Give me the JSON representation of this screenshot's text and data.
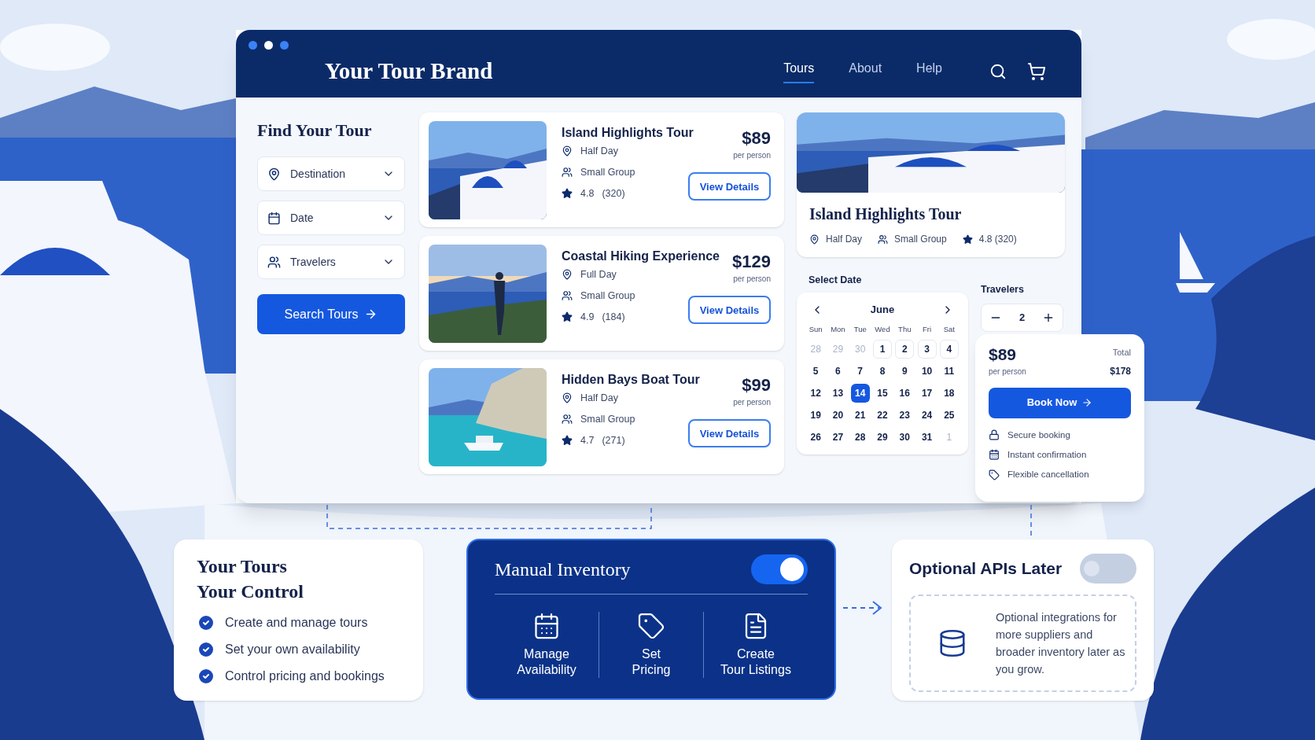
{
  "header": {
    "brand": "Your Tour Brand",
    "nav": [
      {
        "label": "Tours",
        "selected": true
      },
      {
        "label": "About",
        "selected": false
      },
      {
        "label": "Help",
        "selected": false
      }
    ]
  },
  "filters": {
    "title": "Find Your Tour",
    "fields": [
      {
        "kind": "location",
        "label": "Destination"
      },
      {
        "kind": "date",
        "label": "Date"
      },
      {
        "kind": "people",
        "label": "Travelers"
      }
    ],
    "button": "Search Tours"
  },
  "tours": [
    {
      "title": "Island Highlights Tour",
      "duration": "Half Day",
      "group": "Small Group",
      "rating": "4.8",
      "reviews": "(320)",
      "price": "$89",
      "unit": "per person",
      "button": "View Details"
    },
    {
      "title": "Coastal Hiking Experience",
      "duration": "Full Day",
      "group": "Small Group",
      "rating": "4.9",
      "reviews": "(184)",
      "price": "$129",
      "unit": "per person",
      "button": "View Details"
    },
    {
      "title": "Hidden Bays Boat Tour",
      "duration": "Half Day",
      "group": "Small Group",
      "rating": "4.7",
      "reviews": "(271)",
      "price": "$99",
      "unit": "per person",
      "button": "View Details"
    }
  ],
  "detail": {
    "title": "Island Highlights Tour",
    "duration": "Half Day",
    "group": "Small Group",
    "rating": "4.8 (320)"
  },
  "calendar": {
    "label": "Select Date",
    "month": "June",
    "weekdays": [
      "Sun",
      "Mon",
      "Tue",
      "Wed",
      "Thu",
      "Fri",
      "Sat"
    ],
    "days": [
      {
        "label": "28",
        "muted": true,
        "selected": false,
        "boxed": false
      },
      {
        "label": "29",
        "muted": true,
        "selected": false,
        "boxed": false
      },
      {
        "label": "30",
        "muted": true,
        "selected": false,
        "boxed": false
      },
      {
        "label": "1",
        "muted": false,
        "selected": false,
        "boxed": true
      },
      {
        "label": "2",
        "muted": false,
        "selected": false,
        "boxed": true
      },
      {
        "label": "3",
        "muted": false,
        "selected": false,
        "boxed": true
      },
      {
        "label": "4",
        "muted": false,
        "selected": false,
        "boxed": true
      },
      {
        "label": "5",
        "muted": false,
        "selected": false,
        "boxed": false
      },
      {
        "label": "6",
        "muted": false,
        "selected": false,
        "boxed": false
      },
      {
        "label": "7",
        "muted": false,
        "selected": false,
        "boxed": false
      },
      {
        "label": "8",
        "muted": false,
        "selected": false,
        "boxed": false
      },
      {
        "label": "9",
        "muted": false,
        "selected": false,
        "boxed": false
      },
      {
        "label": "10",
        "muted": false,
        "selected": false,
        "boxed": false
      },
      {
        "label": "11",
        "muted": false,
        "selected": false,
        "boxed": false
      },
      {
        "label": "12",
        "muted": false,
        "selected": false,
        "boxed": false
      },
      {
        "label": "13",
        "muted": false,
        "selected": false,
        "boxed": false
      },
      {
        "label": "14",
        "muted": false,
        "selected": true,
        "boxed": false
      },
      {
        "label": "15",
        "muted": false,
        "selected": false,
        "boxed": false
      },
      {
        "label": "16",
        "muted": false,
        "selected": false,
        "boxed": false
      },
      {
        "label": "17",
        "muted": false,
        "selected": false,
        "boxed": false
      },
      {
        "label": "18",
        "muted": false,
        "selected": false,
        "boxed": false
      },
      {
        "label": "19",
        "muted": false,
        "selected": false,
        "boxed": false
      },
      {
        "label": "20",
        "muted": false,
        "selected": false,
        "boxed": false
      },
      {
        "label": "21",
        "muted": false,
        "selected": false,
        "boxed": false
      },
      {
        "label": "22",
        "muted": false,
        "selected": false,
        "boxed": false
      },
      {
        "label": "23",
        "muted": false,
        "selected": false,
        "boxed": false
      },
      {
        "label": "24",
        "muted": false,
        "selected": false,
        "boxed": false
      },
      {
        "label": "25",
        "muted": false,
        "selected": false,
        "boxed": false
      },
      {
        "label": "26",
        "muted": false,
        "selected": false,
        "boxed": false
      },
      {
        "label": "27",
        "muted": false,
        "selected": false,
        "boxed": false
      },
      {
        "label": "28",
        "muted": false,
        "selected": false,
        "boxed": false
      },
      {
        "label": "29",
        "muted": false,
        "selected": false,
        "boxed": false
      },
      {
        "label": "30",
        "muted": false,
        "selected": false,
        "boxed": false
      },
      {
        "label": "31",
        "muted": false,
        "selected": false,
        "boxed": false
      },
      {
        "label": "1",
        "muted": true,
        "selected": false,
        "boxed": false
      }
    ]
  },
  "travelers": {
    "label": "Travelers",
    "value": "2"
  },
  "booking": {
    "price": "$89",
    "unit": "per person",
    "total_label": "Total",
    "total": "$178",
    "button": "Book Now",
    "features": [
      {
        "kind": "lock",
        "label": "Secure booking"
      },
      {
        "kind": "calendar",
        "label": "Instant confirmation"
      },
      {
        "kind": "tag",
        "label": "Flexible cancellation"
      }
    ]
  },
  "control_card": {
    "title_lines": [
      "Your Tours",
      "Your Control"
    ],
    "items": [
      {
        "label": "Create and manage tours",
        "checked": true
      },
      {
        "label": "Set your own availability",
        "checked": true
      },
      {
        "label": "Control pricing and bookings",
        "checked": true
      }
    ]
  },
  "inventory": {
    "title": "Manual Inventory",
    "on": true,
    "actions": [
      {
        "kind": "calendar",
        "lines": [
          "Manage",
          "Availability"
        ]
      },
      {
        "kind": "tag",
        "lines": [
          "Set",
          "Pricing"
        ]
      },
      {
        "kind": "list",
        "lines": [
          "Create",
          "Tour Listings"
        ]
      }
    ]
  },
  "apis": {
    "title": "Optional APIs Later",
    "on": false,
    "text": "Optional integrations for more suppliers and broader inventory later as you grow."
  }
}
